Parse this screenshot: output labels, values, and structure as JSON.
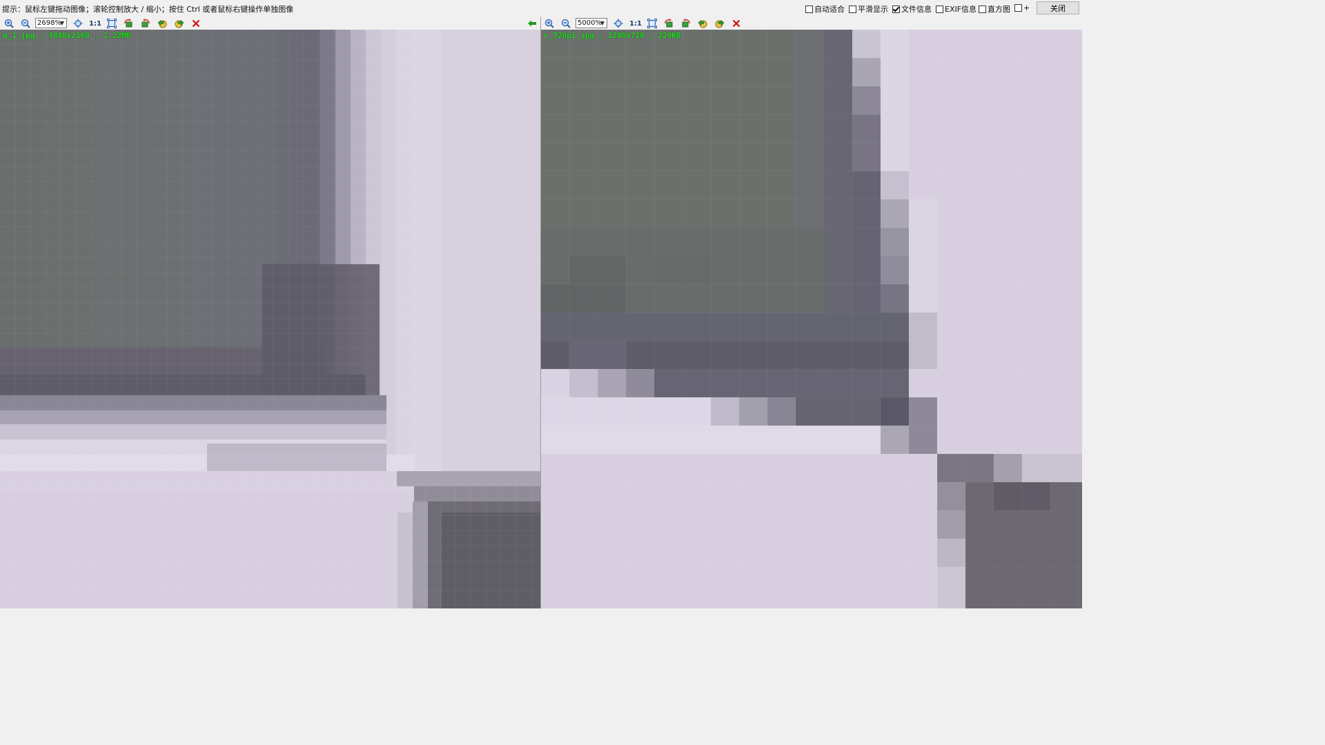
{
  "hint": "提示：鼠标左键拖动图像；滚轮控制放大 / 缩小；按住 Ctrl 或者鼠标右键操作单独图像",
  "options": [
    {
      "label": "自动适合",
      "checked": false
    },
    {
      "label": "平滑显示",
      "checked": false
    },
    {
      "label": "文件信息",
      "checked": true
    },
    {
      "label": "EXIF信息",
      "checked": false
    },
    {
      "label": "直方图",
      "checked": false
    },
    {
      "label": "+",
      "checked": false
    }
  ],
  "close_label": "关闭",
  "panes": {
    "left": {
      "zoom": "2698%",
      "file_info": "d_1.jpg , 3840x2160 , 1.22MB",
      "actual_size_label": "1:1"
    },
    "right": {
      "zoom": "5000%",
      "file_info": "r_720p1.jpg , 1280x720 , 229KB",
      "actual_size_label": "1:1"
    }
  },
  "colors": {
    "dark_region": "#6b6f6d",
    "light_region": "#d6cedf",
    "edge_dark": "#5f5c6a",
    "file_info_text": "#1ee01e",
    "close_red": "#d01010",
    "arrow_green": "#1a9a1a"
  }
}
